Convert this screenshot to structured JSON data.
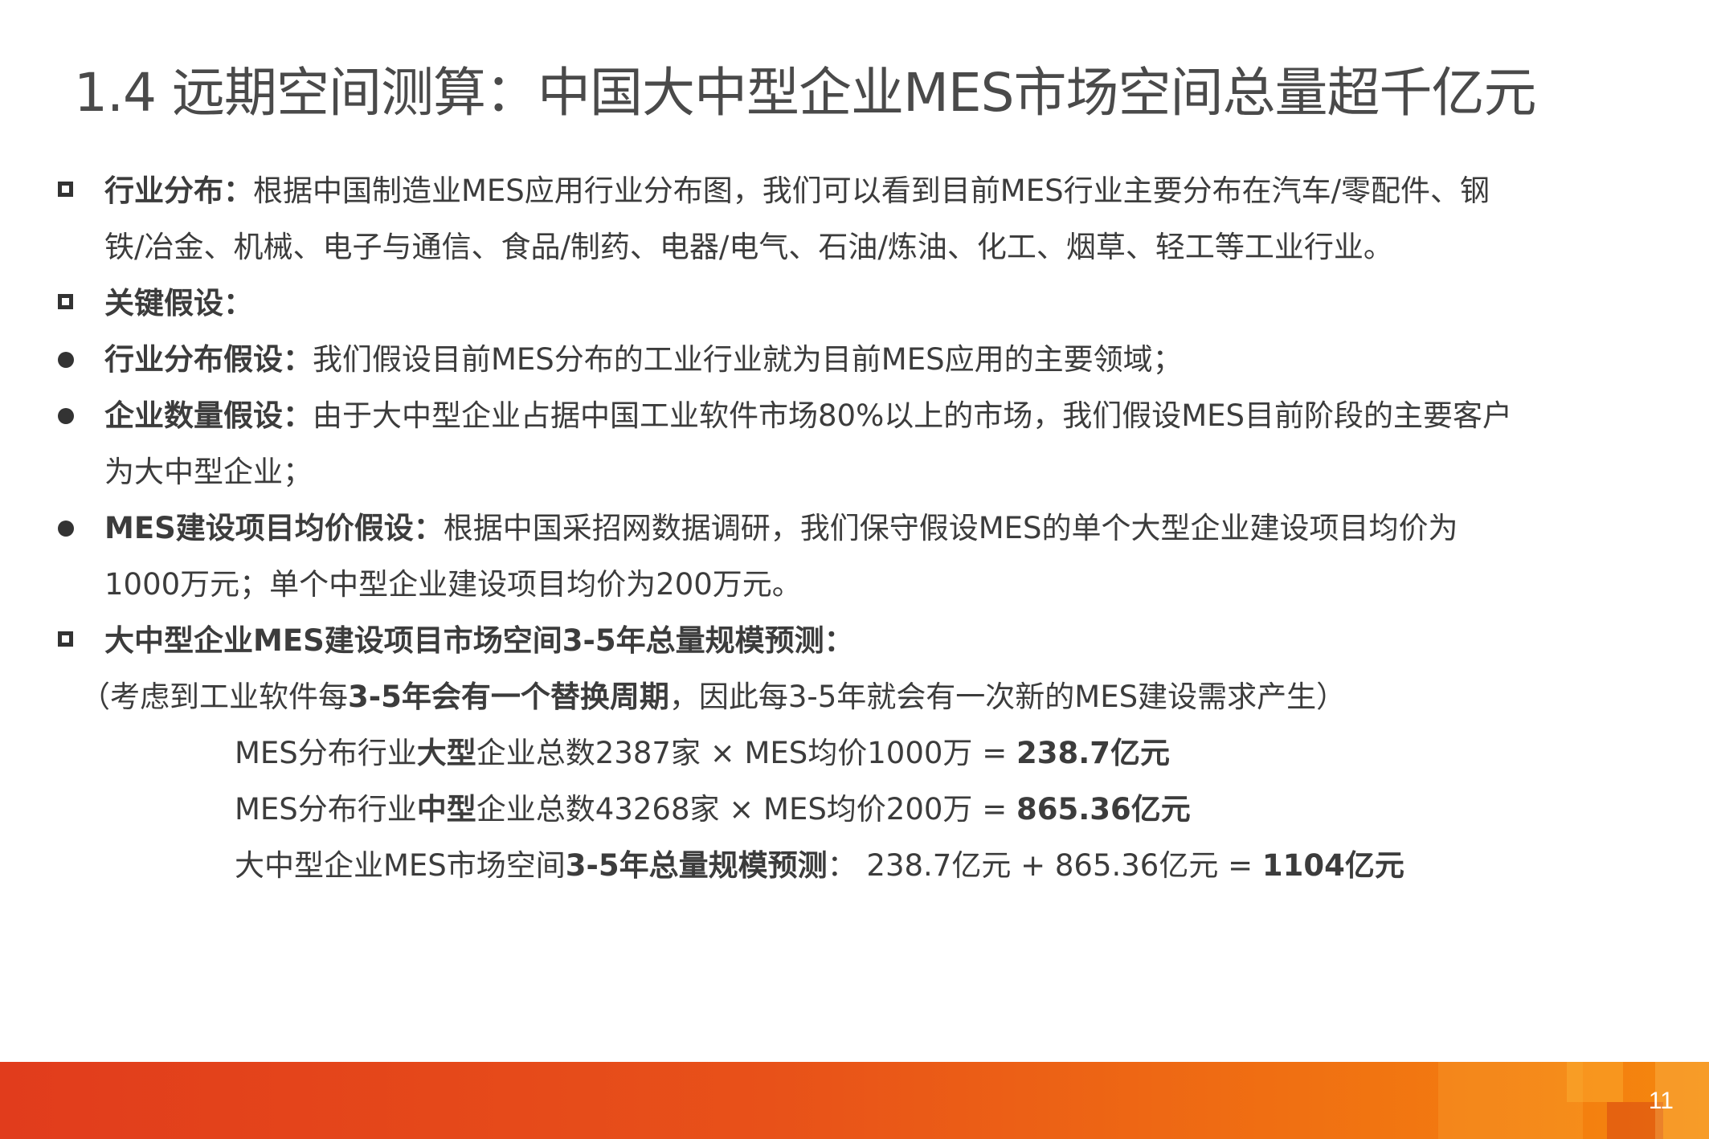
{
  "title": "1.4 远期空间测算：中国大中型企业MES市场空间总量超千亿元",
  "items": [
    {
      "label": "行业分布：",
      "text1": "根据中国制造业MES应用行业分布图，我们可以看到目前MES行业主要分布在汽车/零配件、钢",
      "text2": "铁/冶金、机械、电子与通信、食品/制药、电器/电气、石油/炼油、化工、烟草、轻工等工业行业。"
    },
    {
      "label": "关键假设："
    },
    {
      "label": "行业分布假设：",
      "text1": "我们假设目前MES分布的工业行业就为目前MES应用的主要领域；"
    },
    {
      "label": "企业数量假设：",
      "text1": "由于大中型企业占据中国工业软件市场80%以上的市场，我们假设MES目前阶段的主要客户",
      "text2": "为大中型企业；"
    },
    {
      "label": "MES建设项目均价假设：",
      "text1": "根据中国采招网数据调研，我们保守假设MES的单个大型企业建设项目均价为",
      "text2": "1000万元；单个中型企业建设项目均价为200万元。"
    },
    {
      "label": "大中型企业MES建设项目市场空间3-5年总量规模预测："
    }
  ],
  "note": {
    "p1": "（考虑到工业软件每",
    "p2": "3-5年会有一个替换周期",
    "p3": "，因此每3-5年就会有一次新的MES建设需求产生）"
  },
  "formulas": [
    {
      "a": "MES分布行业",
      "b": "大型",
      "c": "企业总数2387家 × MES均价1000万 = ",
      "d": "238.7亿元"
    },
    {
      "a": "MES分布行业",
      "b": "中型",
      "c": "企业总数43268家 × MES均价200万 = ",
      "d": "865.36亿元"
    },
    {
      "a": "大中型企业MES市场空间",
      "b": "3-5年总量规模预测",
      "c": "： 238.7亿元 + 865.36亿元 = ",
      "d": "1104亿元"
    }
  ],
  "footer": {
    "page_number": "11"
  },
  "colors": {
    "footer_start": "#e13c1c",
    "footer_end": "#f5870e",
    "text": "#3c3c3c"
  }
}
